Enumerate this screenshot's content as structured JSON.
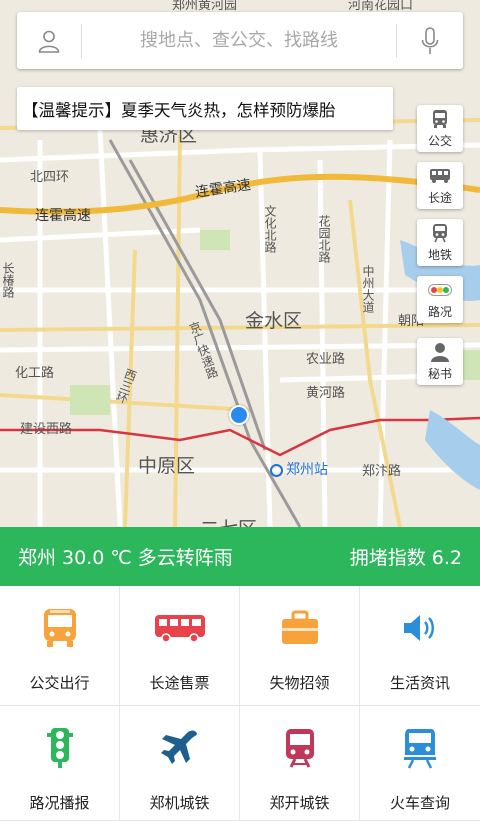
{
  "search": {
    "placeholder": "搜地点、查公交、找路线"
  },
  "tip": {
    "text": "【温馨提示】夏季天气炎热，怎样预防爆胎"
  },
  "side_buttons": [
    {
      "label": "公交",
      "icon": "bus-icon"
    },
    {
      "label": "长途",
      "icon": "coach-icon"
    },
    {
      "label": "地铁",
      "icon": "subway-icon"
    },
    {
      "label": "路况",
      "icon": "traffic-light-icon"
    },
    {
      "label": "秘书",
      "icon": "secretary-icon"
    }
  ],
  "map": {
    "labels": {
      "top_center": "郑州黄河园",
      "top_right": "河南花园口",
      "area_top": "惠济区",
      "beisihuan": "北四环",
      "lianhuo_east": "连霍高速",
      "lianhuo_west": "连霍高速",
      "changchun": "长椿路",
      "wenhua": "文化北路",
      "huayuan": "花园北路",
      "zhongzhou": "中州大道",
      "jinshui": "金水区",
      "chaoyang": "朝阳",
      "jingguang": "京广快速路",
      "nongye": "农业路",
      "huanghe": "黄河路",
      "xisanhuan": "西三环",
      "huagong": "化工路",
      "jianshe": "建设西路",
      "zhongyuan": "中原区",
      "station": "郑州站",
      "zhengbian": "郑汴路",
      "erqi": "二七区"
    }
  },
  "weather": {
    "text": "郑州 30.0 ℃ 多云转阵雨",
    "congestion": "拥堵指数 6.2"
  },
  "grid": [
    {
      "label": "公交出行",
      "icon": "bus-icon",
      "color": "#f7a23b"
    },
    {
      "label": "长途售票",
      "icon": "coach-icon",
      "color": "#e8434b"
    },
    {
      "label": "失物招领",
      "icon": "briefcase-icon",
      "color": "#f7a23b"
    },
    {
      "label": "生活资讯",
      "icon": "speaker-icon",
      "color": "#2b8ed8"
    },
    {
      "label": "路况播报",
      "icon": "traffic-light-icon",
      "color": "#2db75c"
    },
    {
      "label": "郑机城铁",
      "icon": "airplane-icon",
      "color": "#1f5f8f"
    },
    {
      "label": "郑开城铁",
      "icon": "train-icon",
      "color": "#c0375a"
    },
    {
      "label": "火车查询",
      "icon": "railway-icon",
      "color": "#2b8ed8"
    }
  ]
}
